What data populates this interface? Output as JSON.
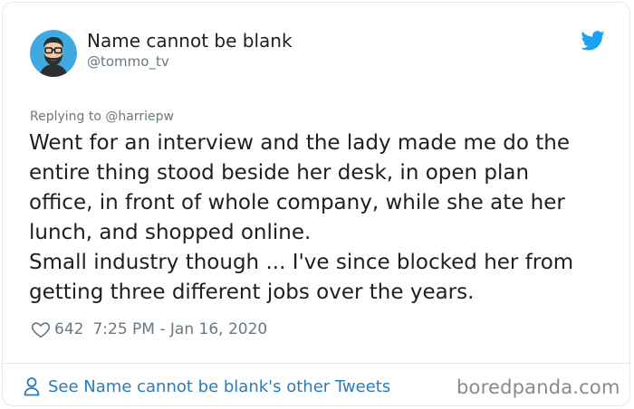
{
  "author": {
    "display_name": "Name cannot be blank",
    "handle": "@tommo_tv",
    "avatar": "avatar-illustration"
  },
  "brand": {
    "icon": "twitter-bird-icon",
    "color": "#1da1f2"
  },
  "tweet": {
    "replying_to": "Replying to @harriepw",
    "lines": [
      "Went for an interview and the lady made me do the",
      "entire thing stood beside her desk, in open plan",
      "office, in front of whole company, while she ate her",
      "lunch, and shopped online.",
      "Small industry though ... I've since blocked her from",
      "getting three different jobs over the years."
    ],
    "likes": "642",
    "timestamp": "7:25 PM - Jan 16, 2020"
  },
  "footer": {
    "link_text": "See Name cannot be blank's other Tweets",
    "link_color": "#2b7bb9",
    "watermark": "boredpanda.com"
  }
}
